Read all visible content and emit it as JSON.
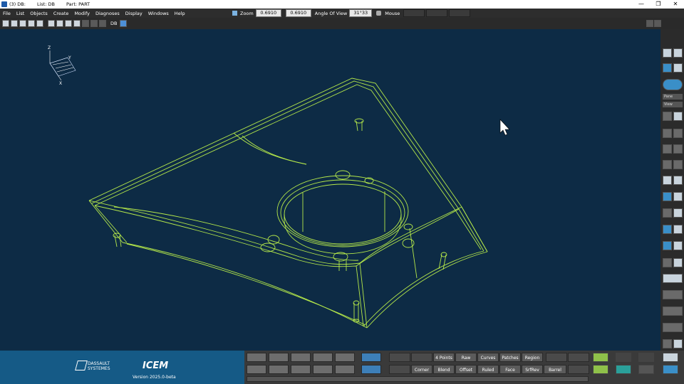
{
  "titlebar": {
    "db": "(3) DB:",
    "list": "List: DB",
    "part": "Part: PART",
    "minimize": "—",
    "restore": "❐",
    "close": "✕"
  },
  "menu": [
    "File",
    "List",
    "Objects",
    "Create",
    "Modify",
    "Diagnoses",
    "Display",
    "Windows",
    "Help"
  ],
  "zoom": {
    "label": "Zoom",
    "value1": "0.6910",
    "value2": "0.6910",
    "aov_label": "Angle Of View",
    "aov_value": "31°33",
    "mouse_label": "Mouse"
  },
  "toolbar": {
    "db_label": "DB"
  },
  "triad": {
    "x": "X",
    "y": "Y",
    "z": "Z"
  },
  "brand": {
    "company_line1": "DASSAULT",
    "company_line2": "SYSTEMES",
    "product": "ICEM",
    "version": "Version 2025.0-beta"
  },
  "commands_row1": [
    "4 Points",
    "Raw",
    "Curves",
    "Patches",
    "Region"
  ],
  "commands_row2": [
    "Corner",
    "Blend",
    "Offset",
    "Ruled",
    "Face",
    "SrfRev",
    "Barrel"
  ],
  "right_labels": {
    "pane": "Pane",
    "view": "View"
  },
  "colors": {
    "background": "#0d2b45",
    "wireframe": "#b5e84a",
    "logo_bg": "#155a86"
  }
}
